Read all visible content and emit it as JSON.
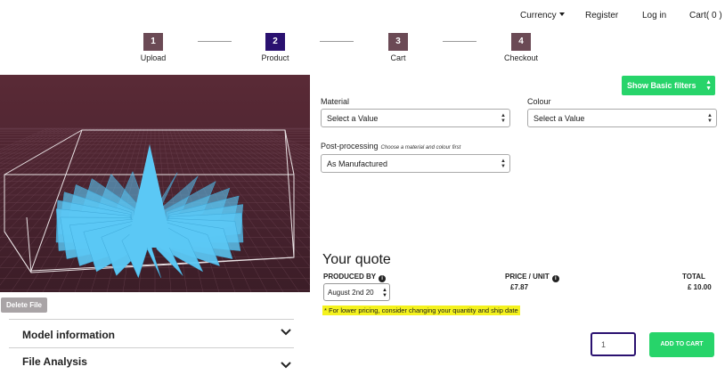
{
  "nav": {
    "currency": "Currency",
    "register": "Register",
    "login": "Log in",
    "cart": "Cart( 0 )"
  },
  "steps": [
    {
      "num": "1",
      "label": "Upload"
    },
    {
      "num": "2",
      "label": "Product",
      "active": true
    },
    {
      "num": "3",
      "label": "Cart"
    },
    {
      "num": "4",
      "label": "Checkout"
    }
  ],
  "viewer": {
    "delete_label": "Delete File",
    "model_color": "#5bc8f5",
    "bg_color": "#4a2430"
  },
  "accordions": [
    {
      "title": "Model information"
    },
    {
      "title": "File Analysis"
    }
  ],
  "filters": {
    "toggle_label": "Show Basic filters"
  },
  "fields": {
    "material": {
      "label": "Material",
      "value": "Select a Value"
    },
    "colour": {
      "label": "Colour",
      "value": "Select a Value"
    },
    "post_processing": {
      "label": "Post-processing",
      "hint": "Choose a material and colour first",
      "value": "As Manufactured"
    }
  },
  "quote": {
    "title": "Your quote",
    "produced_by_label": "PRODUCED BY",
    "produced_by_value": "August 2nd 20",
    "price_unit_label": "PRICE / UNIT",
    "price_unit_value": "£7.87",
    "total_label": "TOTAL",
    "total_value": "£ 10.00",
    "notice": "* For lower pricing, consider changing your quantity and ship date",
    "quantity": "1",
    "add_to_cart_label": "ADD TO CART"
  },
  "colors": {
    "accent_green": "#27d46a",
    "step_active": "#2a1170",
    "step_inactive": "#6b4a55",
    "notice_bg": "#f4f21e"
  }
}
